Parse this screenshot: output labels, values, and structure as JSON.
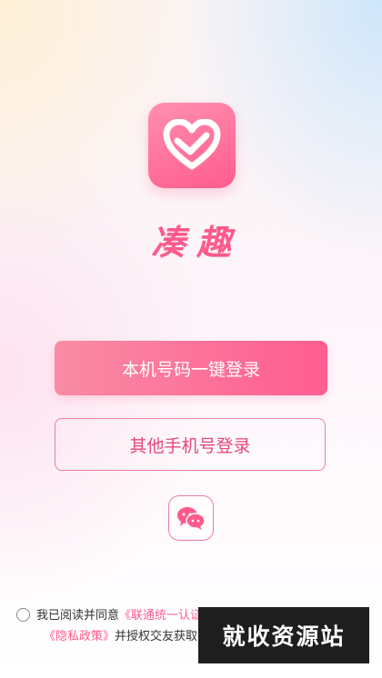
{
  "app": {
    "name": "凑趣",
    "logo_icon": "heart-icon"
  },
  "buttons": {
    "one_click_login": "本机号码一键登录",
    "other_phone_login": "其他手机号登录",
    "wechat_icon": "wechat-icon"
  },
  "agreement": {
    "prefix": "我已阅读并同意",
    "link1": "《联通统一认证",
    "link2": "《隐私政策》",
    "suffix": "并授权交友获取"
  },
  "watermark": "就收资源站",
  "colors": {
    "accent": "#ff5a8c",
    "button_start": "#f98ba4",
    "button_end": "#ff5d91"
  }
}
